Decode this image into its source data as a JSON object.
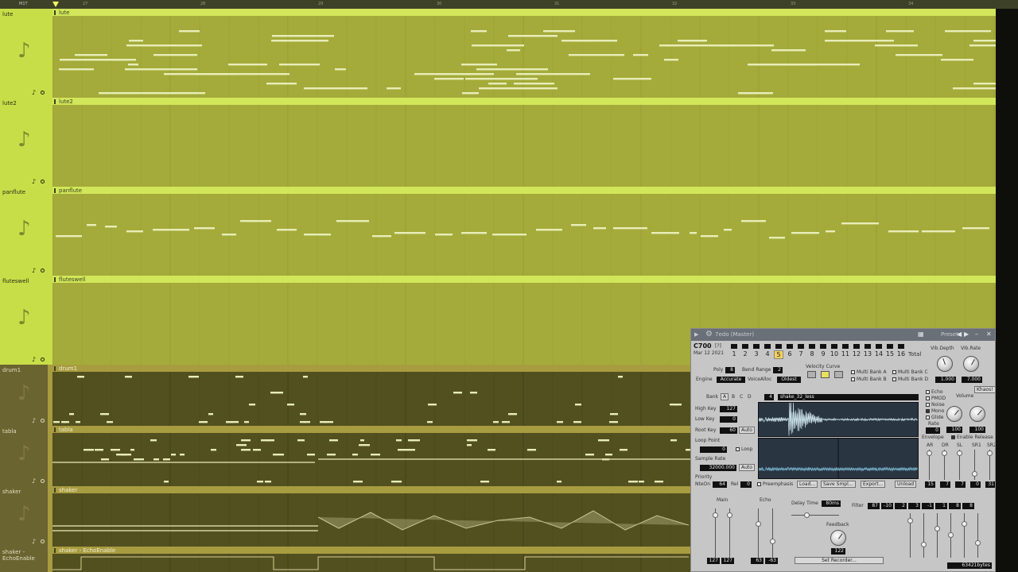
{
  "ruler": {
    "brand": "M1T",
    "ticks": [
      "27",
      "28",
      "29",
      "30",
      "31",
      "32",
      "33",
      "34"
    ]
  },
  "tracks": [
    {
      "name": "lute",
      "clip": "lute",
      "notes": true
    },
    {
      "name": "lute2",
      "clip": "lute2",
      "notes": false
    },
    {
      "name": "panflute",
      "clip": "panflute",
      "notes": true
    },
    {
      "name": "fluteswell",
      "clip": "fluteswell",
      "notes": false
    },
    {
      "name": "drum1",
      "clip": "drum1",
      "notes": true
    },
    {
      "name": "tabla",
      "clip": "tabla",
      "notes": true
    },
    {
      "name": "shaker",
      "clip": "shaker",
      "notes": true
    },
    {
      "name": "shaker - EchoEnable",
      "clip": "shaker - EchoEnable",
      "notes": false
    }
  ],
  "colors": {
    "bright_track": "#a4ab3a",
    "dark_track": "#535020",
    "clip_bar": "#d2e65a",
    "note": "#e8edb8"
  },
  "icons": {
    "track": "music-note-icon",
    "settings": "gear-icon",
    "close": "close-icon"
  },
  "plugin": {
    "title": "7edo (Master)",
    "presets_label": "Presets",
    "model": "C700",
    "version": "[?]",
    "date": "Mar 12 2021",
    "program_label": "Total",
    "programs": [
      "1",
      "2",
      "3",
      "4",
      "5",
      "6",
      "7",
      "8",
      "9",
      "10",
      "11",
      "12",
      "13",
      "14",
      "15",
      "16"
    ],
    "selected_program": "5",
    "vib_depth_label": "Vib.Depth",
    "vib_rate_label": "Vib.Rate",
    "vib_depth": "1.000",
    "vib_rate": "7.000",
    "poly_label": "Poly",
    "poly": "8",
    "bend_range_label": "Bend Range",
    "bend_range": "2",
    "engine_label": "Engine",
    "engine": "Accurate",
    "voice_alloc_label": "VoiceAlloc",
    "voice_alloc": "Oldest",
    "velocity_curve_label": "Velocity Curve",
    "multibank": [
      "Multi Bank A",
      "Multi Bank C",
      "Multi Bank B",
      "Multi Bank D"
    ],
    "bank_label": "Bank",
    "banks": [
      "A",
      "B",
      "C",
      "D"
    ],
    "sample_index": "4",
    "sample_name": "shake_32_less",
    "high_key_label": "High Key",
    "high_key": "127",
    "low_key_label": "Low Key",
    "low_key": "0",
    "root_key_label": "Root Key",
    "root_key": "60",
    "auto_label": "Auto",
    "loop_point_label": "Loop Point",
    "loop_point": "0",
    "loop_label": "Loop",
    "sample_rate_label": "Sample Rate",
    "sample_rate": "32000.000",
    "priority_label": "Priority",
    "note_on_label": "NteOn",
    "note_on": "64",
    "rel_label": "Rel",
    "rel": "0",
    "preemphasis_label": "Preemphasis",
    "load_label": "Load...",
    "save_label": "Save Smpl...",
    "export_label": "Export...",
    "unload_label": "Unload",
    "options": [
      "Echo",
      "PMOD",
      "Noise",
      "Mono",
      "Glide"
    ],
    "glide_rate_label": "Rate",
    "glide_rate": "0",
    "khaos": "Khaos!",
    "volume_label": "Volume",
    "vol_l": "100",
    "vol_r": "100",
    "envelope_label": "Envelope",
    "enable_release_label": "Enable Release",
    "env_labels": [
      "AR",
      "DR",
      "SL",
      "SR1",
      "SR2"
    ],
    "env_values": [
      "15",
      "7",
      "7",
      "0",
      "31"
    ],
    "main_label": "Main",
    "echo_label": "Echo",
    "main_l": "127",
    "main_r": "127",
    "echo_l": "63",
    "echo_r": "-63",
    "delay_time_label": "Delay Time",
    "delay_time": "80ms",
    "feedback_label": "Feedback",
    "feedback": "122",
    "filter_label": "Filter",
    "filter": [
      "87",
      "-10",
      "2",
      "3",
      "-1",
      "1",
      "8",
      "8"
    ],
    "set_recorder_label": "Set Recorder...",
    "bytes": "63421bytes"
  }
}
